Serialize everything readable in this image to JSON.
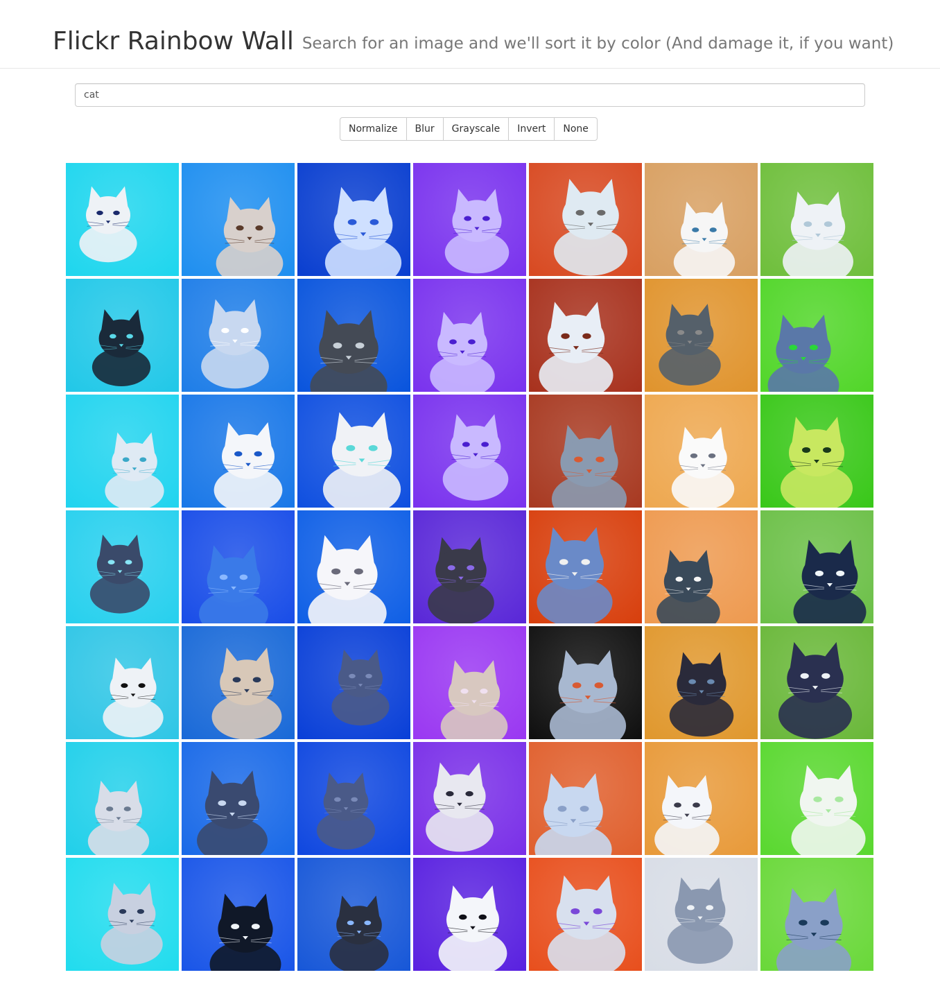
{
  "header": {
    "title": "Flickr Rainbow Wall",
    "subtitle": "Search for an image and we'll sort it by color (And damage it, if you want)"
  },
  "search": {
    "value": "cat",
    "placeholder": ""
  },
  "filters": {
    "active": "Invert",
    "buttons": [
      {
        "id": "normalize",
        "label": "Normalize"
      },
      {
        "id": "blur",
        "label": "Blur"
      },
      {
        "id": "grayscale",
        "label": "Grayscale"
      },
      {
        "id": "invert",
        "label": "Invert"
      },
      {
        "id": "none",
        "label": "None"
      }
    ]
  },
  "gallery": {
    "columns": 7,
    "rows": 7,
    "tiles": [
      {
        "bg": "#1fd6ee",
        "fg": "#eef2f6",
        "accent": "#1a2a6c"
      },
      {
        "bg": "#1f8ff0",
        "fg": "#d8d0cc",
        "accent": "#5a3a2a"
      },
      {
        "bg": "#0a3fd0",
        "fg": "#cfe0ff",
        "accent": "#2a5ad8"
      },
      {
        "bg": "#7a33ee",
        "fg": "#c9b9ff",
        "accent": "#4a1fd0"
      },
      {
        "bg": "#d84a22",
        "fg": "#dfeaf2",
        "accent": "#6a6a6a"
      },
      {
        "bg": "#d8a062",
        "fg": "#f6f6f6",
        "accent": "#3a7aa8"
      },
      {
        "bg": "#6fbf3c",
        "fg": "#eef2f6",
        "accent": "#b0c8d8"
      },
      {
        "bg": "#22c8e8",
        "fg": "#1a2a3a",
        "accent": "#5ad8e8"
      },
      {
        "bg": "#1f7ee8",
        "fg": "#c8d8f0",
        "accent": "#ffffff"
      },
      {
        "bg": "#0a55dd",
        "fg": "#444a55",
        "accent": "#c8d0d8"
      },
      {
        "bg": "#7a33ee",
        "fg": "#c9b9ff",
        "accent": "#4a1fd0"
      },
      {
        "bg": "#a8321e",
        "fg": "#e8eef6",
        "accent": "#7a2a1a"
      },
      {
        "bg": "#e0942e",
        "fg": "#55606a",
        "accent": "#8a8a8a"
      },
      {
        "bg": "#52d62a",
        "fg": "#5a78a8",
        "accent": "#2ad63a"
      },
      {
        "bg": "#22d4ef",
        "fg": "#dfeaf4",
        "accent": "#3aa8c8"
      },
      {
        "bg": "#1a78e8",
        "fg": "#f4f6fa",
        "accent": "#1a58c8"
      },
      {
        "bg": "#1050e0",
        "fg": "#f0f2f6",
        "accent": "#5ad8d8"
      },
      {
        "bg": "#7a33ee",
        "fg": "#c9b9ff",
        "accent": "#4a1fd0"
      },
      {
        "bg": "#a83a22",
        "fg": "#8a9ab0",
        "accent": "#d85a32"
      },
      {
        "bg": "#eea850",
        "fg": "#fafafa",
        "accent": "#6a7080"
      },
      {
        "bg": "#3ac81a",
        "fg": "#c8e860",
        "accent": "#1a3a1a"
      },
      {
        "bg": "#28d0ee",
        "fg": "#3a4a6a",
        "accent": "#88e6f6"
      },
      {
        "bg": "#1a4ee8",
        "fg": "#3a7ae8",
        "accent": "#8ab8ff"
      },
      {
        "bg": "#1060e6",
        "fg": "#f6f6fa",
        "accent": "#6a6a7a"
      },
      {
        "bg": "#5a28d8",
        "fg": "#3a3a4a",
        "accent": "#8a6ae8"
      },
      {
        "bg": "#d8400e",
        "fg": "#6a8ac8",
        "accent": "#f0f0f0"
      },
      {
        "bg": "#ee9a50",
        "fg": "#3a4a5a",
        "accent": "#f6f6f6"
      },
      {
        "bg": "#6cc048",
        "fg": "#1a2a4a",
        "accent": "#f0f6fa"
      },
      {
        "bg": "#30c6e6",
        "fg": "#eef2f6",
        "accent": "#101010"
      },
      {
        "bg": "#1a6ad8",
        "fg": "#d8c8b8",
        "accent": "#2a3a5a"
      },
      {
        "bg": "#0a40d8",
        "fg": "#4a5a88",
        "accent": "#7a8ab8"
      },
      {
        "bg": "#9a38f2",
        "fg": "#d8c8c0",
        "accent": "#f0e0f0"
      },
      {
        "bg": "#101010",
        "fg": "#a8b8d0",
        "accent": "#d85a32"
      },
      {
        "bg": "#e0982e",
        "fg": "#2a2a3a",
        "accent": "#6a8ab0"
      },
      {
        "bg": "#6ab83a",
        "fg": "#2a3050",
        "accent": "#eef2f6"
      },
      {
        "bg": "#22d0ea",
        "fg": "#d8dde8",
        "accent": "#6a7a90"
      },
      {
        "bg": "#1a6ae8",
        "fg": "#3a4a70",
        "accent": "#c8d8f0"
      },
      {
        "bg": "#1048e0",
        "fg": "#4a5a88",
        "accent": "#7a8ab8"
      },
      {
        "bg": "#7a30e8",
        "fg": "#e8e8f0",
        "accent": "#2a2a3a"
      },
      {
        "bg": "#e0602e",
        "fg": "#c8d8f0",
        "accent": "#8aa0c8"
      },
      {
        "bg": "#e89a3a",
        "fg": "#f4f6fa",
        "accent": "#3a3a4a"
      },
      {
        "bg": "#5ad830",
        "fg": "#f0f6f0",
        "accent": "#a8e8a0"
      },
      {
        "bg": "#22dcee",
        "fg": "#c8d0e0",
        "accent": "#2a3a5a"
      },
      {
        "bg": "#1a56e8",
        "fg": "#101828",
        "accent": "#f0f4fa"
      },
      {
        "bg": "#1858d8",
        "fg": "#2a3040",
        "accent": "#8ab8ff"
      },
      {
        "bg": "#5a22e0",
        "fg": "#f4f6fa",
        "accent": "#101018"
      },
      {
        "bg": "#e8501e",
        "fg": "#d8e0ee",
        "accent": "#7a48d8"
      },
      {
        "bg": "#d8dde6",
        "fg": "#8a98b0",
        "accent": "#eef2f6"
      },
      {
        "bg": "#6ad83a",
        "fg": "#8aa0c8",
        "accent": "#1a3a5a"
      }
    ]
  }
}
